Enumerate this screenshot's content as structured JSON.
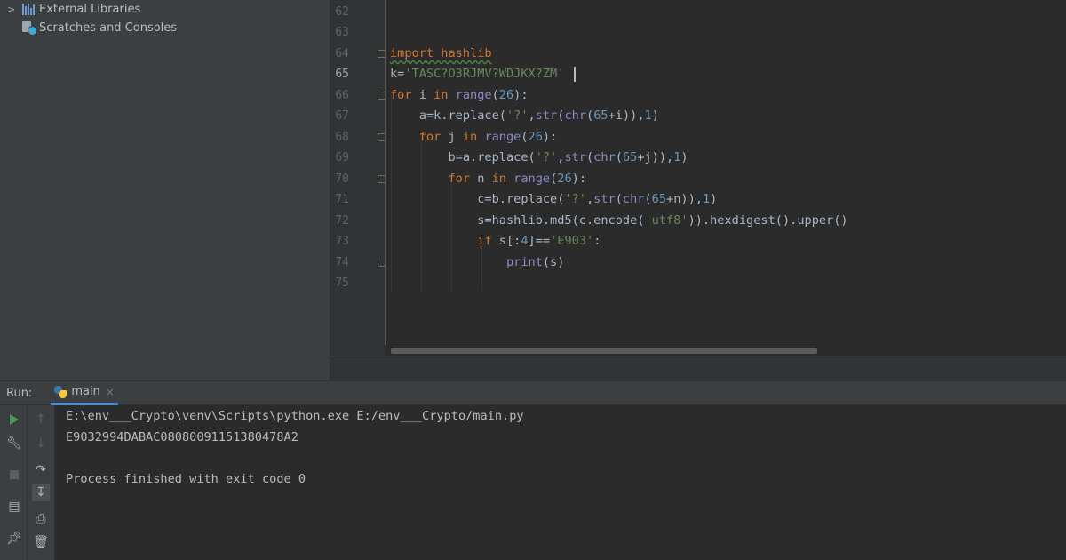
{
  "project_tree": {
    "items": [
      {
        "label": "External Libraries",
        "icon": "library-icon"
      },
      {
        "label": "Scratches and Consoles",
        "icon": "scratches-icon"
      }
    ]
  },
  "editor": {
    "current_line": "65",
    "line_numbers": [
      "62",
      "63",
      "64",
      "65",
      "66",
      "67",
      "68",
      "69",
      "70",
      "71",
      "72",
      "73",
      "74",
      "75"
    ],
    "code_lines": [
      "",
      "",
      "import hashlib",
      "k='TASC?O3RJMV?WDJKX?ZM'",
      "for i in range(26):",
      "    a=k.replace('?',str(chr(65+i)),1)",
      "    for j in range(26):",
      "        b=a.replace('?',str(chr(65+j)),1)",
      "        for n in range(26):",
      "            c=b.replace('?',str(chr(65+n)),1)",
      "            s=hashlib.md5(c.encode('utf8')).hexdigest().upper()",
      "            if s[:4]=='E903':",
      "                print(s)",
      ""
    ]
  },
  "run_panel": {
    "label": "Run:",
    "tab_name": "main",
    "tab_close": "×",
    "output_lines": [
      "E:\\env___Crypto\\venv\\Scripts\\python.exe E:/env___Crypto/main.py",
      "E9032994DABAC08080091151380478A2",
      "",
      "Process finished with exit code 0"
    ]
  },
  "colors": {
    "keyword": "#cc7832",
    "string": "#6a8759",
    "number": "#6897bb",
    "builtin": "#8888c6",
    "run_green": "#499c54"
  }
}
